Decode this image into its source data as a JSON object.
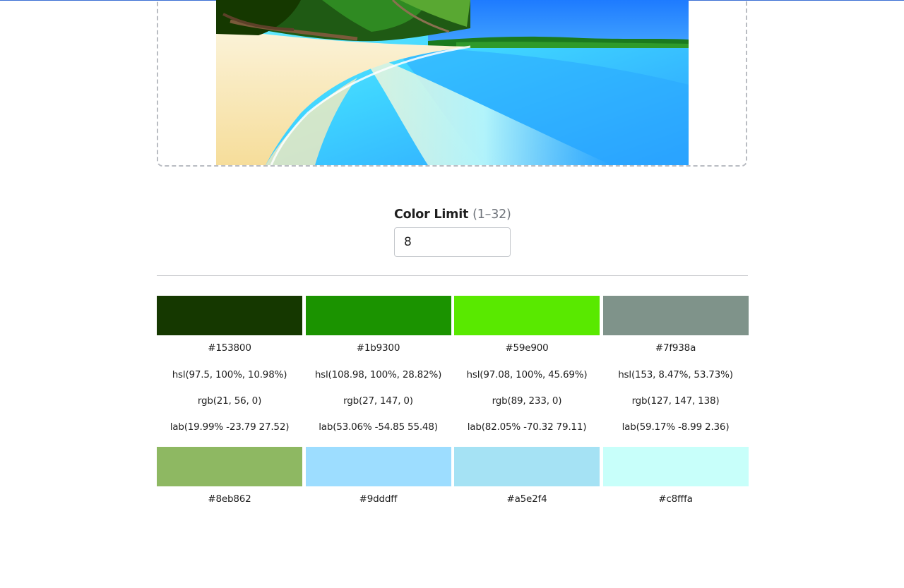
{
  "color_limit": {
    "label": "Color Limit",
    "range": "(1–32)",
    "value": "8"
  },
  "palette": [
    {
      "color": "#153800",
      "hex": "#153800",
      "hsl": "hsl(97.5, 100%, 10.98%)",
      "rgb": "rgb(21, 56, 0)",
      "lab": "lab(19.99% -23.79 27.52)"
    },
    {
      "color": "#1b9300",
      "hex": "#1b9300",
      "hsl": "hsl(108.98, 100%, 28.82%)",
      "rgb": "rgb(27, 147, 0)",
      "lab": "lab(53.06% -54.85 55.48)"
    },
    {
      "color": "#59e900",
      "hex": "#59e900",
      "hsl": "hsl(97.08, 100%, 45.69%)",
      "rgb": "rgb(89, 233, 0)",
      "lab": "lab(82.05% -70.32 79.11)"
    },
    {
      "color": "#7f938a",
      "hex": "#7f938a",
      "hsl": "hsl(153, 8.47%, 53.73%)",
      "rgb": "rgb(127, 147, 138)",
      "lab": "lab(59.17% -8.99 2.36)"
    },
    {
      "color": "#8eb862",
      "hex": "#8eb862",
      "hsl": "",
      "rgb": "",
      "lab": ""
    },
    {
      "color": "#9dddff",
      "hex": "#9dddff",
      "hsl": "",
      "rgb": "",
      "lab": ""
    },
    {
      "color": "#a5e2f4",
      "hex": "#a5e2f4",
      "hsl": "",
      "rgb": "",
      "lab": ""
    },
    {
      "color": "#c8fffa",
      "hex": "#c8fffa",
      "hsl": "",
      "rgb": "",
      "lab": ""
    }
  ]
}
